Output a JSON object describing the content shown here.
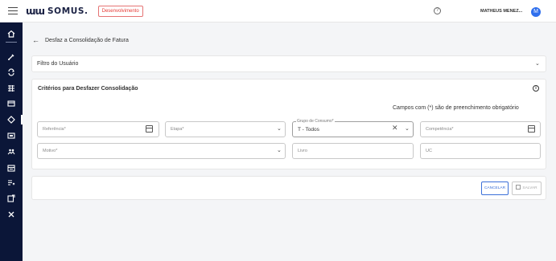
{
  "header": {
    "logo_mark": "ɯɯ",
    "logo_text": "SOMUS.",
    "env_badge": "Desenvolvimento",
    "user_name": "MATHEUS MENEZ...",
    "avatar_letter": "M",
    "help_glyph": "?"
  },
  "sidebar": {
    "items": [
      "home-icon",
      "brush-icon",
      "cycle-icon",
      "table-icon",
      "card-icon",
      "diamond-icon",
      "slides-icon",
      "people-icon",
      "calendar-icon",
      "list-filter-icon",
      "edit-note-icon",
      "tools-icon"
    ],
    "active_item": "diamond-icon"
  },
  "page": {
    "back_glyph": "←",
    "title": "Desfaz a Consolidação de Fatura"
  },
  "filter_panel": {
    "title": "Filtro do Usuário"
  },
  "criteria_panel": {
    "title": "Critérios para Desfazer Consolidação",
    "required_note": "Campos com (*) são de preenchimento obrigatório",
    "fields": {
      "referencia": {
        "placeholder": "Referência*"
      },
      "etapa": {
        "placeholder": "Etapa*"
      },
      "grupo_consumo": {
        "label": "Grupo de Consumo*",
        "value": "T - Todos"
      },
      "competencia": {
        "placeholder": "Competência*"
      },
      "motivo": {
        "placeholder": "Motivo*"
      },
      "livro": {
        "placeholder": "Livro"
      },
      "uc": {
        "placeholder": "UC"
      }
    }
  },
  "actions": {
    "cancel_label": "CANCELAR",
    "save_label": "SALVAR"
  },
  "colors": {
    "sidebar_bg": "#0b1638",
    "accent": "#3b6fd8",
    "avatar": "#2f6fed",
    "env_badge": "#e53935"
  }
}
